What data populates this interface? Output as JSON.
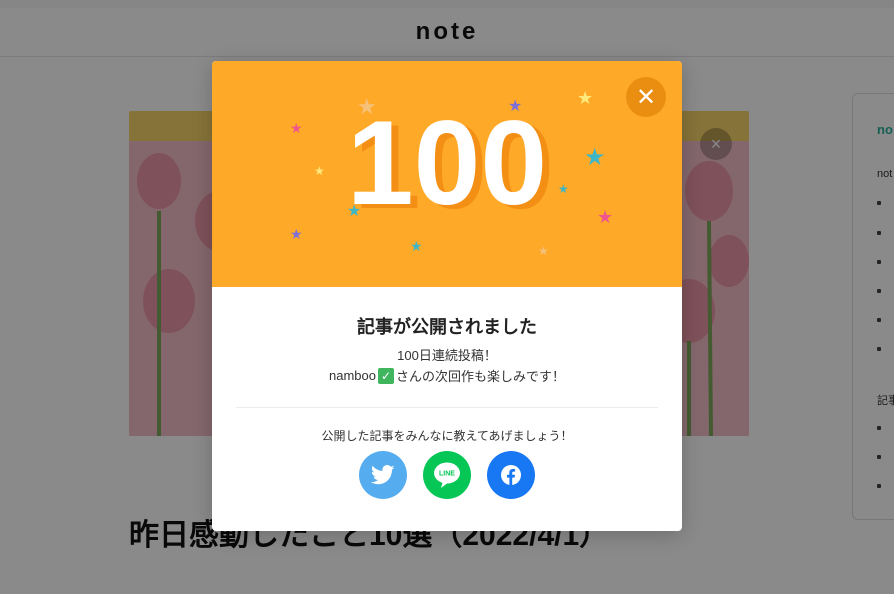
{
  "header": {
    "logo": "note"
  },
  "hero": {
    "close_icon": "×"
  },
  "article": {
    "title": "昨日感動したこと10選（2022/4/1）"
  },
  "sidebar": {
    "title": "no",
    "text1": "not",
    "text2": "記事"
  },
  "modal": {
    "number": "100",
    "close_icon": "✕",
    "heading": "記事が公開されました",
    "line1": "100日連続投稿！",
    "username": "namboo",
    "line2_suffix": "さんの次回作も楽しみです！",
    "share_prompt": "公開した記事をみんなに教えてあげましょう！",
    "share_buttons": [
      "twitter",
      "line",
      "facebook"
    ],
    "line_label": "LINE"
  },
  "colors": {
    "accent": "#ffa929",
    "twitter": "#55acee",
    "line": "#06c755",
    "facebook": "#1877f2",
    "brand_green": "#2ab09b"
  },
  "icons": {
    "check": "✓",
    "star": "★"
  }
}
